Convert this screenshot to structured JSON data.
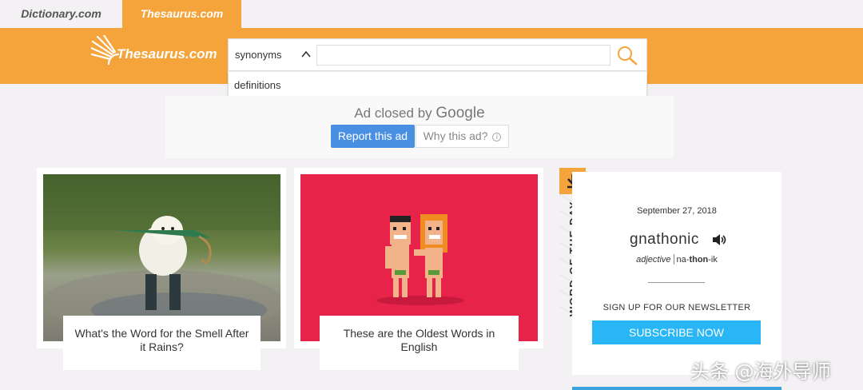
{
  "site_tabs": {
    "dictionary": "Dictionary.com",
    "thesaurus": "Thesaurus.com"
  },
  "logo": {
    "text": "Thesaurus.com"
  },
  "search": {
    "mode": "synonyms",
    "placeholder": "",
    "value": "",
    "dropdown_option": "definitions"
  },
  "ad": {
    "closed_by": "Ad closed by",
    "google": "Google",
    "report": "Report this ad",
    "why": "Why this ad?",
    "info": "i"
  },
  "cards": [
    {
      "caption": "What's the Word for the Smell After it Rains?"
    },
    {
      "caption": "These are the Oldest Words in English"
    }
  ],
  "wotd": {
    "label": "WORD OF THE DAY",
    "date": "September 27, 2018",
    "word": "gnathonic",
    "pos": "adjective",
    "pron_a": "na-",
    "pron_b": "thon",
    "pron_c": "-ik",
    "newsletter": "SIGN UP FOR OUR NEWSLETTER",
    "subscribe": "SUBSCRIBE NOW"
  },
  "watermark": "头条 @海外导师",
  "colors": {
    "brand_orange": "#f4a43a",
    "ad_blue": "#4a90e2",
    "subscribe_blue": "#29b6f6",
    "card_red": "#e8234a"
  }
}
